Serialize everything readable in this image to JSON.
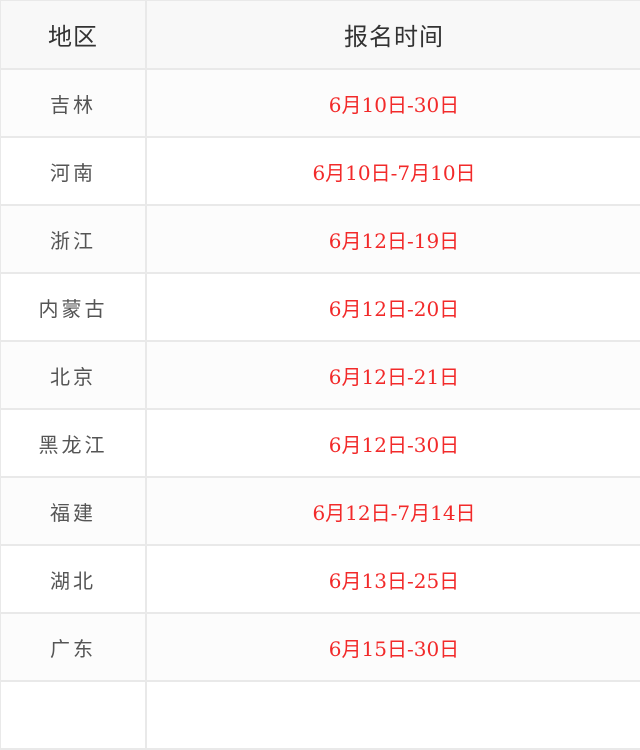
{
  "table": {
    "headers": [
      "地区",
      "报名时间"
    ],
    "accent_color": "#f22a2a",
    "rows": [
      {
        "region": "吉林",
        "date": "6月10日-30日"
      },
      {
        "region": "河南",
        "date": "6月10日-7月10日"
      },
      {
        "region": "浙江",
        "date": "6月12日-19日"
      },
      {
        "region": "内蒙古",
        "date": "6月12日-20日"
      },
      {
        "region": "北京",
        "date": "6月12日-21日"
      },
      {
        "region": "黑龙江",
        "date": "6月12日-30日"
      },
      {
        "region": "福建",
        "date": "6月12日-7月14日"
      },
      {
        "region": "湖北",
        "date": "6月13日-25日"
      },
      {
        "region": "广东",
        "date": "6月15日-30日"
      }
    ]
  }
}
